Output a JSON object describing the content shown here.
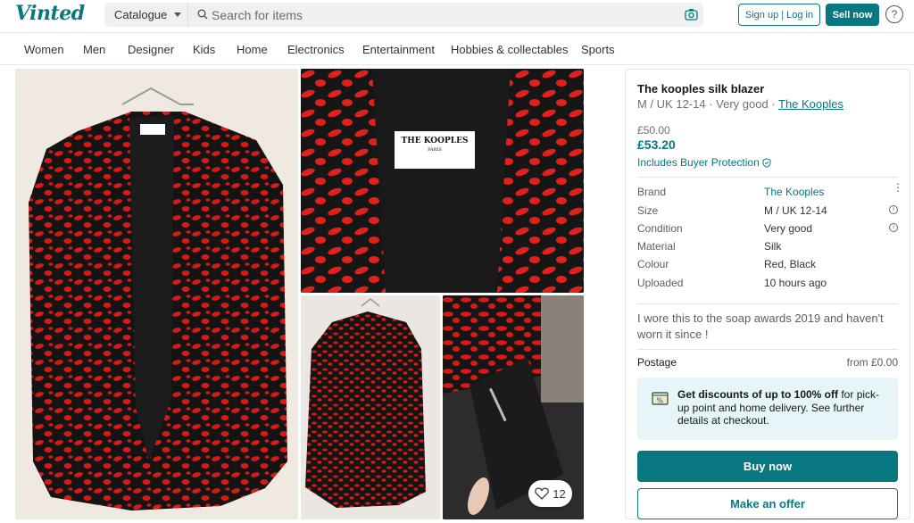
{
  "header": {
    "logo": "Vinted",
    "catalogue_label": "Catalogue",
    "search_placeholder": "Search for items",
    "signup_label": "Sign up | Log in",
    "sell_label": "Sell now",
    "help_label": "?"
  },
  "nav": {
    "items": [
      "Women",
      "Men",
      "Designer",
      "Kids",
      "Home",
      "Electronics",
      "Entertainment",
      "Hobbies & collectables",
      "Sports"
    ]
  },
  "gallery": {
    "label_brand": "THE KOOPLES",
    "label_city": "PARIS",
    "likes_count": "12"
  },
  "item": {
    "title": "The kooples silk blazer",
    "subtitle_prefix": "M / UK 12-14 · Very good · ",
    "subtitle_brand": "The Kooples",
    "price_original": "£50.00",
    "price_total": "£53.20",
    "buyer_protection": "Includes Buyer Protection",
    "details": [
      {
        "label": "Brand",
        "value": "The Kooples"
      },
      {
        "label": "Size",
        "value": "M / UK 12-14"
      },
      {
        "label": "Condition",
        "value": "Very good"
      },
      {
        "label": "Material",
        "value": "Silk"
      },
      {
        "label": "Colour",
        "value": "Red, Black"
      },
      {
        "label": "Uploaded",
        "value": "10 hours ago"
      }
    ],
    "description": "I wore this to the soap awards 2019 and haven't worn it since !",
    "postage_label": "Postage",
    "postage_value": "from £0.00",
    "promo_bold": "Get discounts of up to 100% off",
    "promo_rest": " for pick-up point and home delivery. See further details at checkout.",
    "buy_label": "Buy now",
    "offer_label": "Make an offer"
  },
  "colors": {
    "brand_teal": "#09777f",
    "leopard_red": "#d61a16",
    "promo_bg": "#e6f6f8"
  }
}
